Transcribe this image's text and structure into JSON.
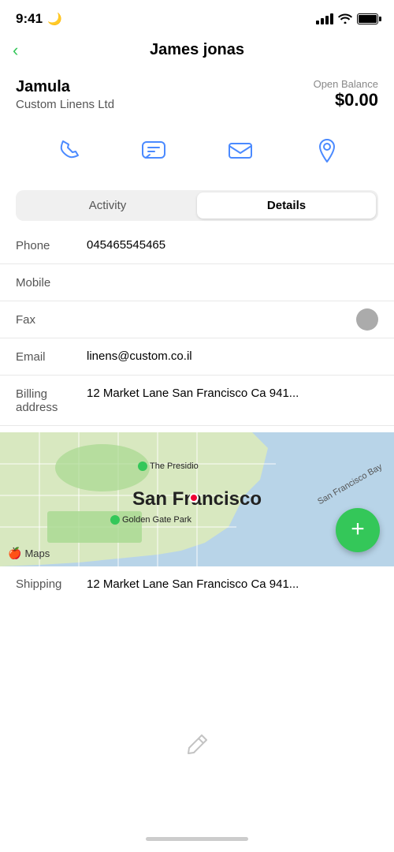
{
  "status": {
    "time": "9:41",
    "moon": "🌙"
  },
  "header": {
    "back_label": "‹",
    "title": "James jonas"
  },
  "contact": {
    "company_name": "Jamula",
    "company_sub": "Custom Linens Ltd",
    "balance_label": "Open Balance",
    "balance_amount": "$0.00"
  },
  "actions": {
    "phone_label": "phone",
    "message_label": "message",
    "email_label": "email",
    "location_label": "location"
  },
  "tabs": {
    "activity_label": "Activity",
    "details_label": "Details",
    "active": "details"
  },
  "fields": {
    "phone_label": "Phone",
    "phone_value": "045465545465",
    "mobile_label": "Mobile",
    "mobile_value": "",
    "fax_label": "Fax",
    "fax_value": "",
    "email_label": "Email",
    "email_value": "linens@custom.co.il",
    "billing_label": "Billing\naddress",
    "billing_value": "12 Market Lane San Francisco Ca 941...",
    "shipping_label": "Shipping",
    "shipping_value": "12 Market Lane San Francisco Ca 941..."
  },
  "map": {
    "city": "San Francisco",
    "presidio": "The Presidio",
    "ggpark": "Golden Gate Park",
    "bay": "San Francisco Bay",
    "watermark": "Maps"
  },
  "fab": {
    "label": "+"
  }
}
